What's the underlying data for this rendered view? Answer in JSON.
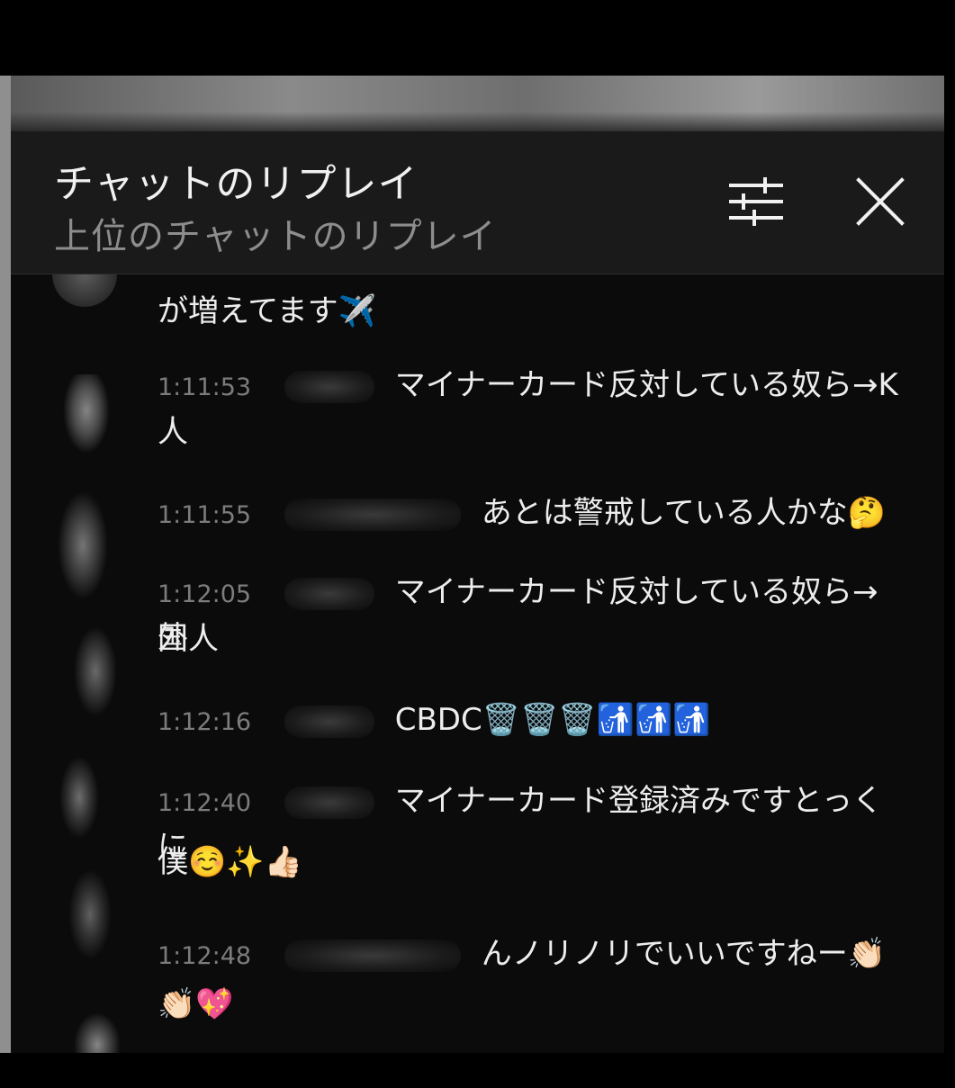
{
  "header": {
    "title": "チャットのリプレイ",
    "subtitle": "上位のチャットのリプレイ"
  },
  "icons": {
    "filter": "sliders-icon",
    "close": "close-icon"
  },
  "messages": [
    {
      "time": "",
      "text": "が増えてます✈️"
    },
    {
      "time": "1:11:53",
      "text": "マイナーカード反対している奴ら→K",
      "cont": "人"
    },
    {
      "time": "1:11:55",
      "text": "あとは警戒している人かな🤔"
    },
    {
      "time": "1:12:05",
      "text": "マイナーカード反対している奴ら→外",
      "cont": "国人"
    },
    {
      "time": "1:12:16",
      "text": "CBDC🗑️🗑️🗑️🚮🚮🚮"
    },
    {
      "time": "1:12:40",
      "text": "マイナーカード登録済みですとっくに",
      "cont": "僕☺️✨👍🏻"
    },
    {
      "time": "1:12:48",
      "text": "んノリノリでいいですねー👏🏻",
      "cont": "👏🏻💖"
    }
  ],
  "colors": {
    "panel_bg": "#0b0b0b",
    "header_bg": "#1a1a1a",
    "text": "#ededed",
    "timestamp": "#7c7c7c"
  }
}
